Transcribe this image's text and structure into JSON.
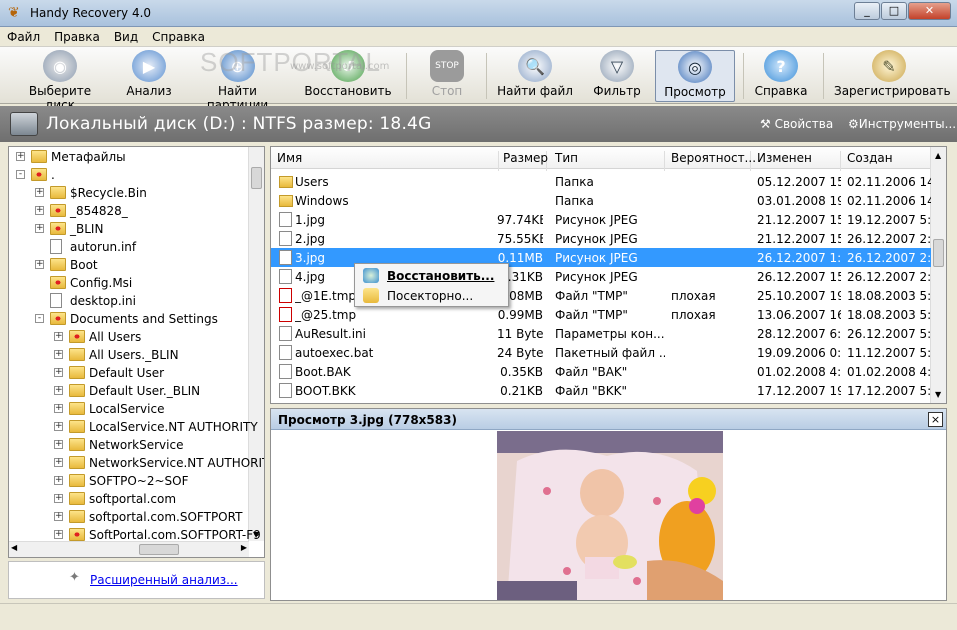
{
  "window": {
    "title": "Handy Recovery 4.0",
    "min": "0",
    "max": "1",
    "close": "r"
  },
  "menu": [
    "Файл",
    "Правка",
    "Вид",
    "Справка"
  ],
  "toolbar": {
    "buttons": [
      {
        "label": "Выберите диск",
        "icon": "disk-select-icon",
        "color": "#7d9cc0"
      },
      {
        "label": "Анализ",
        "icon": "analyze-icon",
        "color": "#5a8fd0"
      },
      {
        "label": "Найти партиции",
        "icon": "find-partitions-icon",
        "color": "#4c86c8"
      },
      {
        "label": "Восстановить",
        "icon": "recover-icon",
        "color": "#4aa04a"
      },
      {
        "label": "Стоп",
        "icon": "stop-icon",
        "color": "#9b9b9b"
      },
      {
        "label": "Найти файл",
        "icon": "find-file-icon",
        "color": "#8aa3c6"
      },
      {
        "label": "Фильтр",
        "icon": "filter-icon",
        "color": "#8a9bb0"
      },
      {
        "label": "Просмотр",
        "icon": "preview-eye-icon",
        "color": "#3a6fb8"
      },
      {
        "label": "Справка",
        "icon": "help-icon",
        "color": "#3c8fd8"
      },
      {
        "label": "Зарегистрировать",
        "icon": "register-icon",
        "color": "#c9a44a"
      }
    ],
    "watermark": "SOFTPORTAL",
    "watermark_sub": "www.softportal.com"
  },
  "pathbar": {
    "text": "Локальный диск (D:) : NTFS размер: 18.4G",
    "properties": "Свойства",
    "tools": "Инструменты..."
  },
  "tree": {
    "items": [
      {
        "label": "Метафайлы",
        "exp": "+",
        "red": false
      },
      {
        "label": ".",
        "exp": "−",
        "red": true
      },
      {
        "label": "$Recycle.Bin",
        "exp": "+",
        "red": false
      },
      {
        "label": "_854828_",
        "exp": "+",
        "red": true
      },
      {
        "label": "_BLIN",
        "exp": "+",
        "red": true
      },
      {
        "label": "autorun.inf",
        "exp": "",
        "red": false,
        "file": true
      },
      {
        "label": "Boot",
        "exp": "+",
        "red": false
      },
      {
        "label": "Config.Msi",
        "exp": "",
        "red": true
      },
      {
        "label": "desktop.ini",
        "exp": "",
        "red": false,
        "file": true
      },
      {
        "label": "Documents and Settings",
        "exp": "−",
        "red": true
      },
      {
        "label": "All Users",
        "exp": "+",
        "red": true
      },
      {
        "label": "All Users._BLIN",
        "exp": "+",
        "red": false
      },
      {
        "label": "Default User",
        "exp": "+",
        "red": false
      },
      {
        "label": "Default User._BLIN",
        "exp": "+",
        "red": false
      },
      {
        "label": "LocalService",
        "exp": "+",
        "red": false
      },
      {
        "label": "LocalService.NT AUTHORITY",
        "exp": "+",
        "red": false
      },
      {
        "label": "NetworkService",
        "exp": "+",
        "red": false
      },
      {
        "label": "NetworkService.NT AUTHORIT",
        "exp": "+",
        "red": false
      },
      {
        "label": "SOFTPO~2~SOF",
        "exp": "+",
        "red": false
      },
      {
        "label": "softportal.com",
        "exp": "+",
        "red": false
      },
      {
        "label": "softportal.com.SOFTPORT",
        "exp": "+",
        "red": false
      },
      {
        "label": "SoftPortal.com.SOFTPORT-F9",
        "exp": "+",
        "red": true
      }
    ]
  },
  "advanced": {
    "link": "Расширенный анализ..."
  },
  "list": {
    "columns": [
      "Имя",
      "Размер",
      "Тип",
      "Вероятност...",
      "Изменен",
      "Создан"
    ],
    "rows": [
      {
        "name": "Users",
        "size": "",
        "type": "Папка",
        "prob": "",
        "modified": "05.12.2007 15...",
        "created": "02.11.2006 14...",
        "icon": "fold"
      },
      {
        "name": "Windows",
        "size": "",
        "type": "Папка",
        "prob": "",
        "modified": "03.01.2008 19...",
        "created": "02.11.2006 14...",
        "icon": "fold"
      },
      {
        "name": "1.jpg",
        "size": "97.74KB",
        "type": "Рисунок JPEG",
        "prob": "",
        "modified": "21.12.2007 15...",
        "created": "19.12.2007 5:...",
        "icon": "file"
      },
      {
        "name": "2.jpg",
        "size": "75.55KB",
        "type": "Рисунок JPEG",
        "prob": "",
        "modified": "21.12.2007 15...",
        "created": "26.12.2007 2:...",
        "icon": "file"
      },
      {
        "name": "3.jpg",
        "size": "0.11MB",
        "type": "Рисунок JPEG",
        "prob": "",
        "modified": "26.12.2007 1:...",
        "created": "26.12.2007 2:...",
        "icon": "file",
        "selected": true
      },
      {
        "name": "4.jpg",
        "size": "4.31KB",
        "type": "Рисунок JPEG",
        "prob": "",
        "modified": "26.12.2007 15...",
        "created": "26.12.2007 2:...",
        "icon": "file"
      },
      {
        "name": "_@1E.tmp",
        "size": "0.08MB",
        "type": "Файл \"TMP\"",
        "prob": "плохая",
        "modified": "25.10.2007 19...",
        "created": "18.08.2003 5:...",
        "icon": "x"
      },
      {
        "name": "_@25.tmp",
        "size": "0.99MB",
        "type": "Файл \"TMP\"",
        "prob": "плохая",
        "modified": "13.06.2007 16...",
        "created": "18.08.2003 5:...",
        "icon": "x"
      },
      {
        "name": "AuResult.ini",
        "size": "11 Bytes",
        "type": "Параметры кон...",
        "prob": "",
        "modified": "28.12.2007 6:...",
        "created": "26.12.2007 5:...",
        "icon": "file"
      },
      {
        "name": "autoexec.bat",
        "size": "24 Bytes",
        "type": "Пакетный файл ...",
        "prob": "",
        "modified": "19.09.2006 0:...",
        "created": "11.12.2007 5:...",
        "icon": "file"
      },
      {
        "name": "Boot.BAK",
        "size": "0.35KB",
        "type": "Файл \"BAK\"",
        "prob": "",
        "modified": "01.02.2008 4:...",
        "created": "01.02.2008 4:...",
        "icon": "file"
      },
      {
        "name": "BOOT.BKK",
        "size": "0.21KB",
        "type": "Файл \"BKK\"",
        "prob": "",
        "modified": "17.12.2007 19...",
        "created": "17.12.2007 5:...",
        "icon": "file"
      }
    ]
  },
  "context_menu": {
    "restore": "Восстановить...",
    "sector": "Посекторно..."
  },
  "preview": {
    "title": "Просмотр 3.jpg (778x583)",
    "close": "×"
  }
}
